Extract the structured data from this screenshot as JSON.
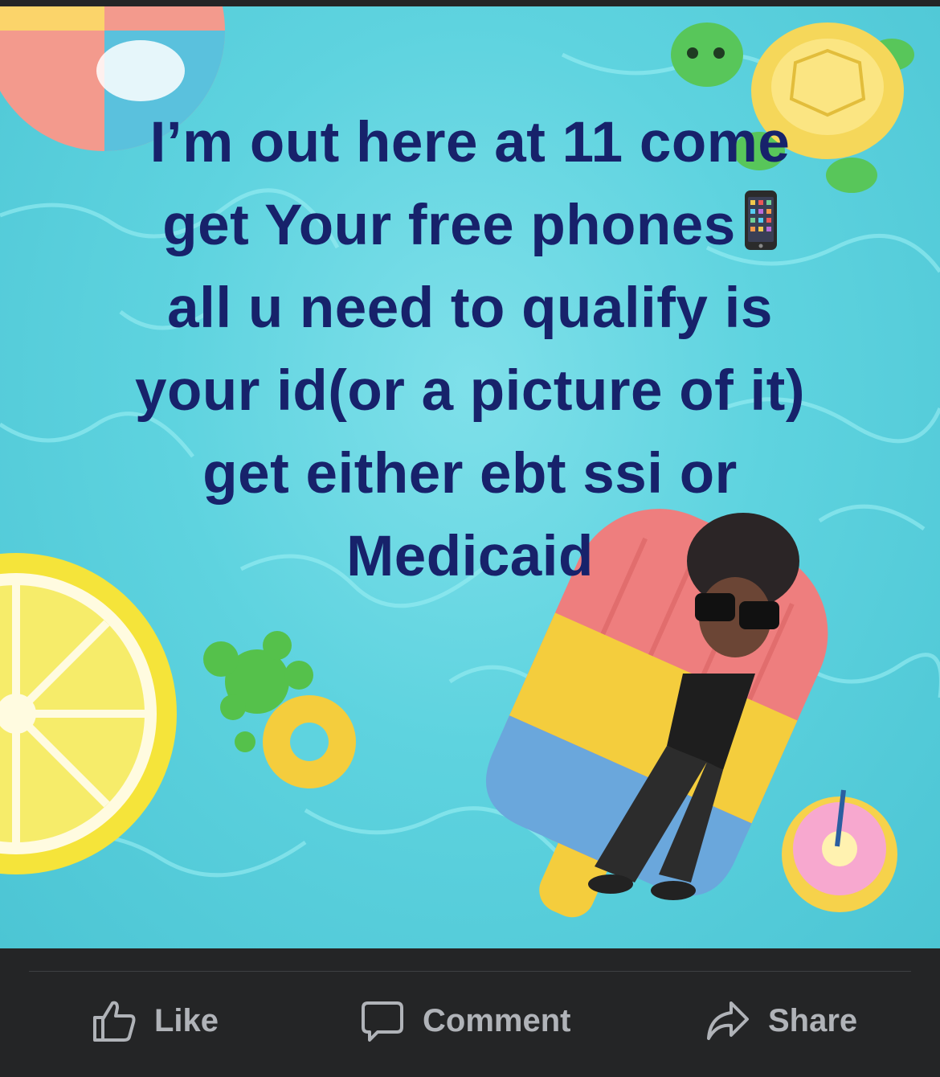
{
  "post": {
    "text_lines": [
      "I’m out here at 11 come",
      "get Your free phones",
      "all u need to qualify is",
      "your id(or a picture of it)",
      "get either ebt ssi or",
      "Medicaid"
    ],
    "emoji_after_line_2": "mobile-phone-emoji",
    "text_color": "#17226b",
    "background_color": "#5ed3df"
  },
  "actions": {
    "like_label": "Like",
    "comment_label": "Comment",
    "share_label": "Share"
  },
  "icons": {
    "like": "thumbs-up-icon",
    "comment": "speech-bubble-icon",
    "share": "share-arrow-icon"
  },
  "theme": {
    "bar_background": "#242526",
    "action_text_color": "#b0b3b8"
  }
}
